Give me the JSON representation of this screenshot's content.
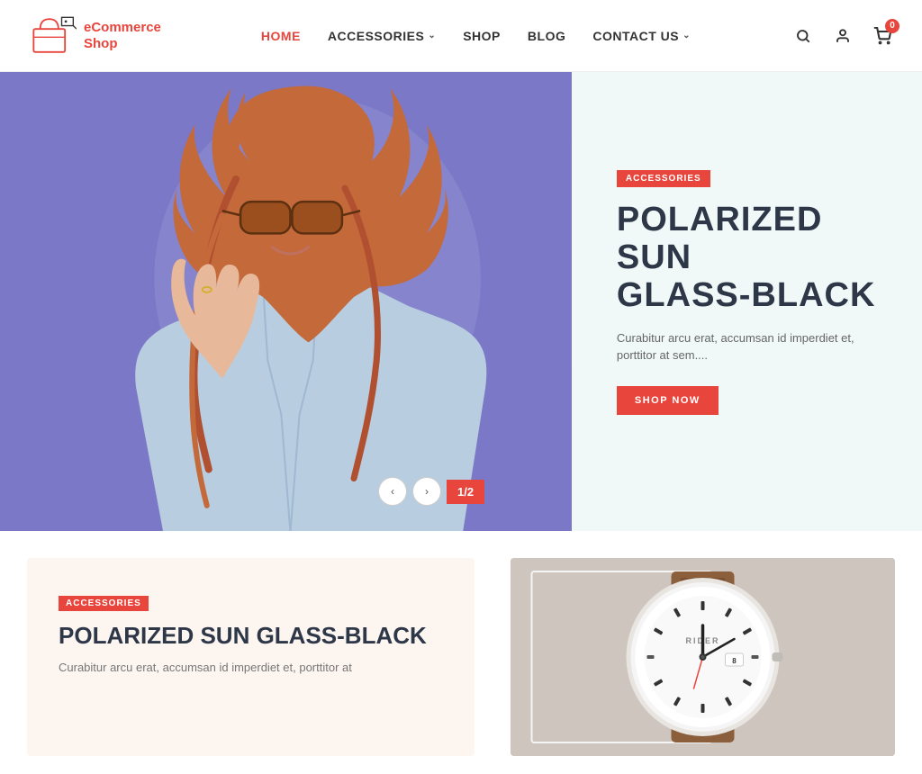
{
  "header": {
    "logo_text_line1": "eCommerce",
    "logo_text_line2": "Shop",
    "nav_items": [
      {
        "label": "HOME",
        "active": true,
        "has_dropdown": false
      },
      {
        "label": "ACCESSORIES",
        "active": false,
        "has_dropdown": true
      },
      {
        "label": "SHOP",
        "active": false,
        "has_dropdown": false
      },
      {
        "label": "BLOG",
        "active": false,
        "has_dropdown": false
      },
      {
        "label": "CONTACT US",
        "active": false,
        "has_dropdown": true
      }
    ],
    "cart_count": "0"
  },
  "hero": {
    "category_badge": "ACCESSORIES",
    "title_line1": "POLARIZED SUN",
    "title_line2": "GLASS-BLACK",
    "description": "Curabitur arcu erat, accumsan id imperdiet et, porttitor at sem....",
    "cta_label": "SHOP NOW",
    "slider_current": "1",
    "slider_total": "2"
  },
  "products": [
    {
      "badge": "ACCESSORIES",
      "title": "POLARIZED SUN GLASS-BLACK",
      "description": "Curabitur arcu erat, accumsan id imperdiet et, porttitor at"
    },
    {
      "type": "watch",
      "image_alt": "Watch product"
    }
  ],
  "icons": {
    "search": "&#128269;",
    "user": "&#128100;",
    "cart": "&#128722;",
    "arrow_left": "&#8249;",
    "arrow_right": "&#8250;"
  }
}
